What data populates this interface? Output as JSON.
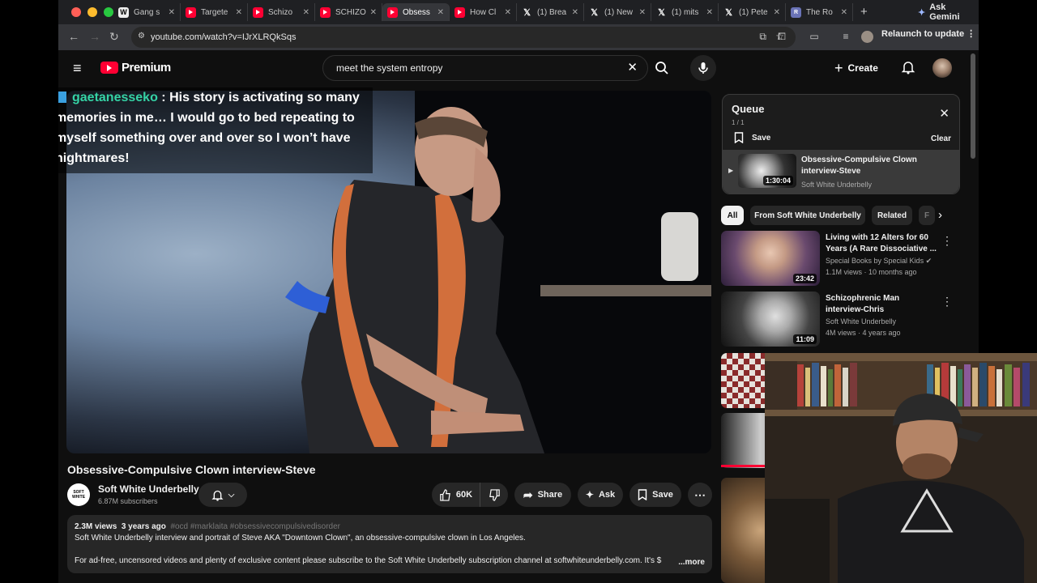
{
  "browser": {
    "tabs": [
      {
        "icon": "wikipedia-icon",
        "title": "Gang s"
      },
      {
        "icon": "youtube-icon",
        "title": "Targete"
      },
      {
        "icon": "youtube-icon",
        "title": "Schizo"
      },
      {
        "icon": "youtube-icon",
        "title": "SCHIZO"
      },
      {
        "icon": "youtube-icon",
        "title": "Obsess",
        "active": true
      },
      {
        "icon": "youtube-icon",
        "title": "How Cl"
      },
      {
        "icon": "x-icon",
        "title": "(1) Brea"
      },
      {
        "icon": "x-icon",
        "title": "(1) New"
      },
      {
        "icon": "x-icon",
        "title": "(1) mits"
      },
      {
        "icon": "x-icon",
        "title": "(1) Pete"
      },
      {
        "icon": "page-icon",
        "title": "The Ro"
      }
    ],
    "gemini_label": "Ask Gemini",
    "url": "youtube.com/watch?v=IJrXLRQkSqs",
    "relaunch_label": "Relaunch to update"
  },
  "youtube": {
    "logo_text": "Premium",
    "search_value": "meet the system entropy",
    "create_label": "Create"
  },
  "overlay": {
    "username": "gaetanesseko",
    "message": " : His story is activating so many memories in me… I would go to bed repeating to myself something over and over so I won’t have nightmares!"
  },
  "video": {
    "title": "Obsessive-Compulsive Clown interview-Steve",
    "channel": "Soft White Underbelly",
    "subscribers": "6.87M subscribers",
    "likes": "60K",
    "share_label": "Share",
    "ask_label": "Ask",
    "save_label": "Save",
    "views": "2.3M views",
    "age": "3 years ago",
    "hashtags": "#ocd #marklaita #obsessivecompulsivedisorder",
    "desc_line1": "Soft White Underbelly interview and portrait of Steve AKA \"Downtown Clown\", an obsessive-compulsive clown in Los Angeles.",
    "desc_line2": "For ad-free, uncensored videos and plenty of exclusive content please subscribe to the Soft White Underbelly subscription channel at softwhiteunderbelly.com. It's $",
    "more_label": "...more"
  },
  "queue": {
    "title": "Queue",
    "position": "1 / 1",
    "save_label": "Save",
    "clear_label": "Clear",
    "item": {
      "title": "Obsessive-Compulsive Clown interview-Steve",
      "channel": "Soft White Underbelly",
      "duration": "1:30:04"
    }
  },
  "chips": [
    "All",
    "From Soft White Underbelly",
    "Related",
    "F"
  ],
  "recommendations": [
    {
      "title": "Living with 12 Alters for 60 Years (A Rare Dissociative ...",
      "channel": "Special Books by Special Kids",
      "meta": "1.1M views · 10 months ago",
      "duration": "23:42"
    },
    {
      "title": "Schizophrenic Man interview-Chris",
      "channel": "Soft White Underbelly",
      "meta": "4M views · 4 years ago",
      "duration": "11:09"
    }
  ],
  "colors": {
    "accent": "#ff0033",
    "background": "#0f0f0f",
    "chat_user": "#35d3a6"
  }
}
